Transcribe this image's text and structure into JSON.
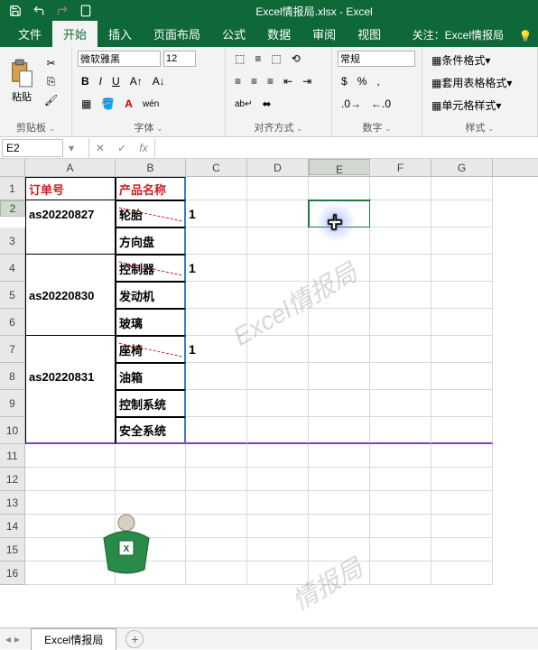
{
  "title": "Excel情报局.xlsx  -  Excel",
  "tabs": [
    "文件",
    "开始",
    "插入",
    "页面布局",
    "公式",
    "数据",
    "审阅",
    "视图"
  ],
  "active_tab": "开始",
  "tab_right": "关注：Excel情报局",
  "ribbon": {
    "clipboard": {
      "paste": "粘贴",
      "label": "剪贴板"
    },
    "font": {
      "name": "微软雅黑",
      "size": "12",
      "label": "字体"
    },
    "align": {
      "label": "对齐方式"
    },
    "number": {
      "format": "常规",
      "label": "数字"
    },
    "styles": {
      "cond": "条件格式",
      "table": "套用表格格式",
      "cell": "单元格样式",
      "label": "样式"
    }
  },
  "namebox": "E2",
  "formula": "",
  "columns": [
    "A",
    "B",
    "C",
    "D",
    "E",
    "F",
    "G"
  ],
  "headers": {
    "A": "订单号",
    "B": "产品名称"
  },
  "table": [
    {
      "order": "as20220827",
      "products": [
        "轮胎",
        "方向盘"
      ],
      "c": "1"
    },
    {
      "order": "as20220830",
      "products": [
        "控制器",
        "发动机",
        "玻璃"
      ],
      "c": "1"
    },
    {
      "order": "as20220831",
      "products": [
        "座椅",
        "油箱",
        "控制系统",
        "安全系统"
      ],
      "c": "1"
    }
  ],
  "watermark1": "Excel情报局",
  "watermark2": "情报局",
  "sheet_name": "Excel情报局",
  "selected_cell": "E2"
}
